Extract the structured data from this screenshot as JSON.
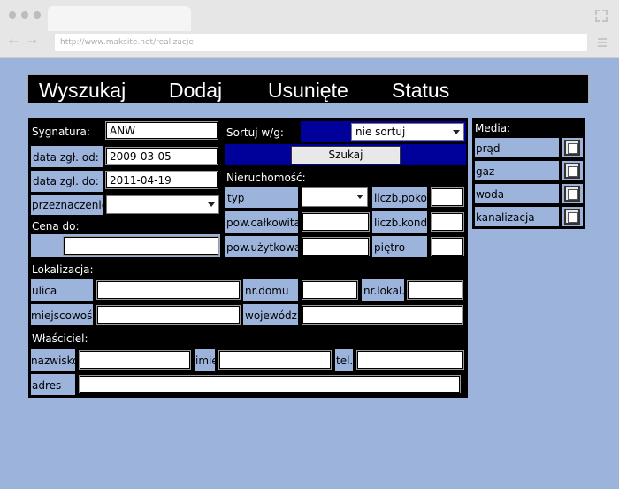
{
  "browser": {
    "url": "http://www.maksite.net/realizacje"
  },
  "nav": {
    "items": [
      "Wyszukaj",
      "Dodaj",
      "Usunięte",
      "Status"
    ]
  },
  "form": {
    "sygnatura": {
      "label": "Sygnatura:",
      "value": "ANW"
    },
    "data_od": {
      "label": "data zgł. od:",
      "value": "2009-03-05"
    },
    "data_do": {
      "label": "data zgł. do:",
      "value": "2011-04-19"
    },
    "przeznaczenie": {
      "label": "przeznaczenie:",
      "value": ""
    },
    "cena": {
      "header": "Cena do:",
      "value": ""
    },
    "sortuj": {
      "label": "Sortuj w/g:",
      "value": "nie sortuj"
    },
    "szukaj": "Szukaj",
    "nieruchomosc": {
      "header": "Nieruchomość:",
      "typ": "typ",
      "pow_calkowita": "pow.całkowita",
      "pow_uzytkowa": "pow.użytkowa",
      "liczb_pokoi": "liczb.pokoi",
      "liczb_kond": "liczb.kond.",
      "pietro": "piętro"
    },
    "lokalizacja": {
      "header": "Lokalizacja:",
      "ulica": "ulica",
      "nr_domu": "nr.domu",
      "nr_lokal": "nr.lokal.",
      "miejscowosc": "miejscowość",
      "wojewodz": "wojewódz."
    },
    "wlasciciel": {
      "header": "Właściciel:",
      "nazwisko": "nazwisko",
      "imie": "imię",
      "tel": "tel.",
      "adres": "adres"
    }
  },
  "media": {
    "header": "Media:",
    "items": [
      "prąd",
      "gaz",
      "woda",
      "kanalizacja"
    ]
  }
}
